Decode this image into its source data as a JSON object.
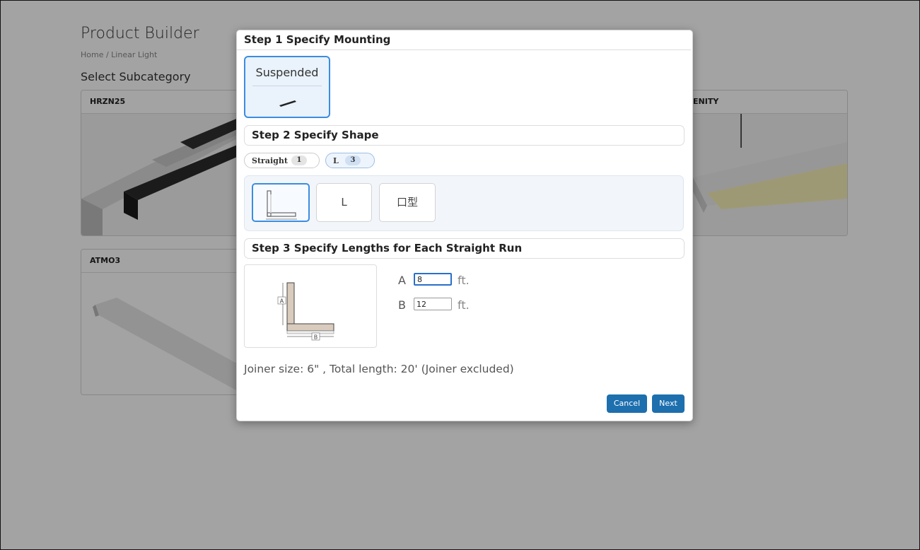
{
  "page": {
    "title": "Product Builder",
    "breadcrumb": "Home / Linear Light",
    "section_title": "Select Subcategory",
    "cards": [
      {
        "name": "HRZN25"
      },
      {
        "name": "ENITY"
      },
      {
        "name": "ATMO3"
      }
    ]
  },
  "modal": {
    "step1": {
      "title": "Step 1 Specify Mounting",
      "options": [
        {
          "label": "Suspended",
          "selected": true
        }
      ]
    },
    "step2": {
      "title": "Step 2 Specify Shape",
      "filters": [
        {
          "label": "Straight",
          "count": "1",
          "active": false
        },
        {
          "label": "L",
          "count": "3",
          "active": true
        }
      ],
      "shapes": [
        {
          "label": "",
          "icon": "l-shape-icon",
          "selected": true
        },
        {
          "label": "L",
          "selected": false
        },
        {
          "label": "口型",
          "selected": false
        }
      ]
    },
    "step3": {
      "title": "Step 3 Specify Lengths for Each Straight Run",
      "diagram_labels": {
        "a": "A",
        "b": "B"
      },
      "lengths": [
        {
          "letter": "A",
          "value": "8",
          "unit": "ft."
        },
        {
          "letter": "B",
          "value": "12",
          "unit": "ft."
        }
      ]
    },
    "summary": "Joiner size: 6\"   , Total length: 20' (Joiner excluded)",
    "buttons": {
      "cancel": "Cancel",
      "next": "Next"
    }
  },
  "colors": {
    "accent": "#3a8de0",
    "button": "#1d6fae",
    "overlay": "rgba(0,0,0,0.36)"
  }
}
